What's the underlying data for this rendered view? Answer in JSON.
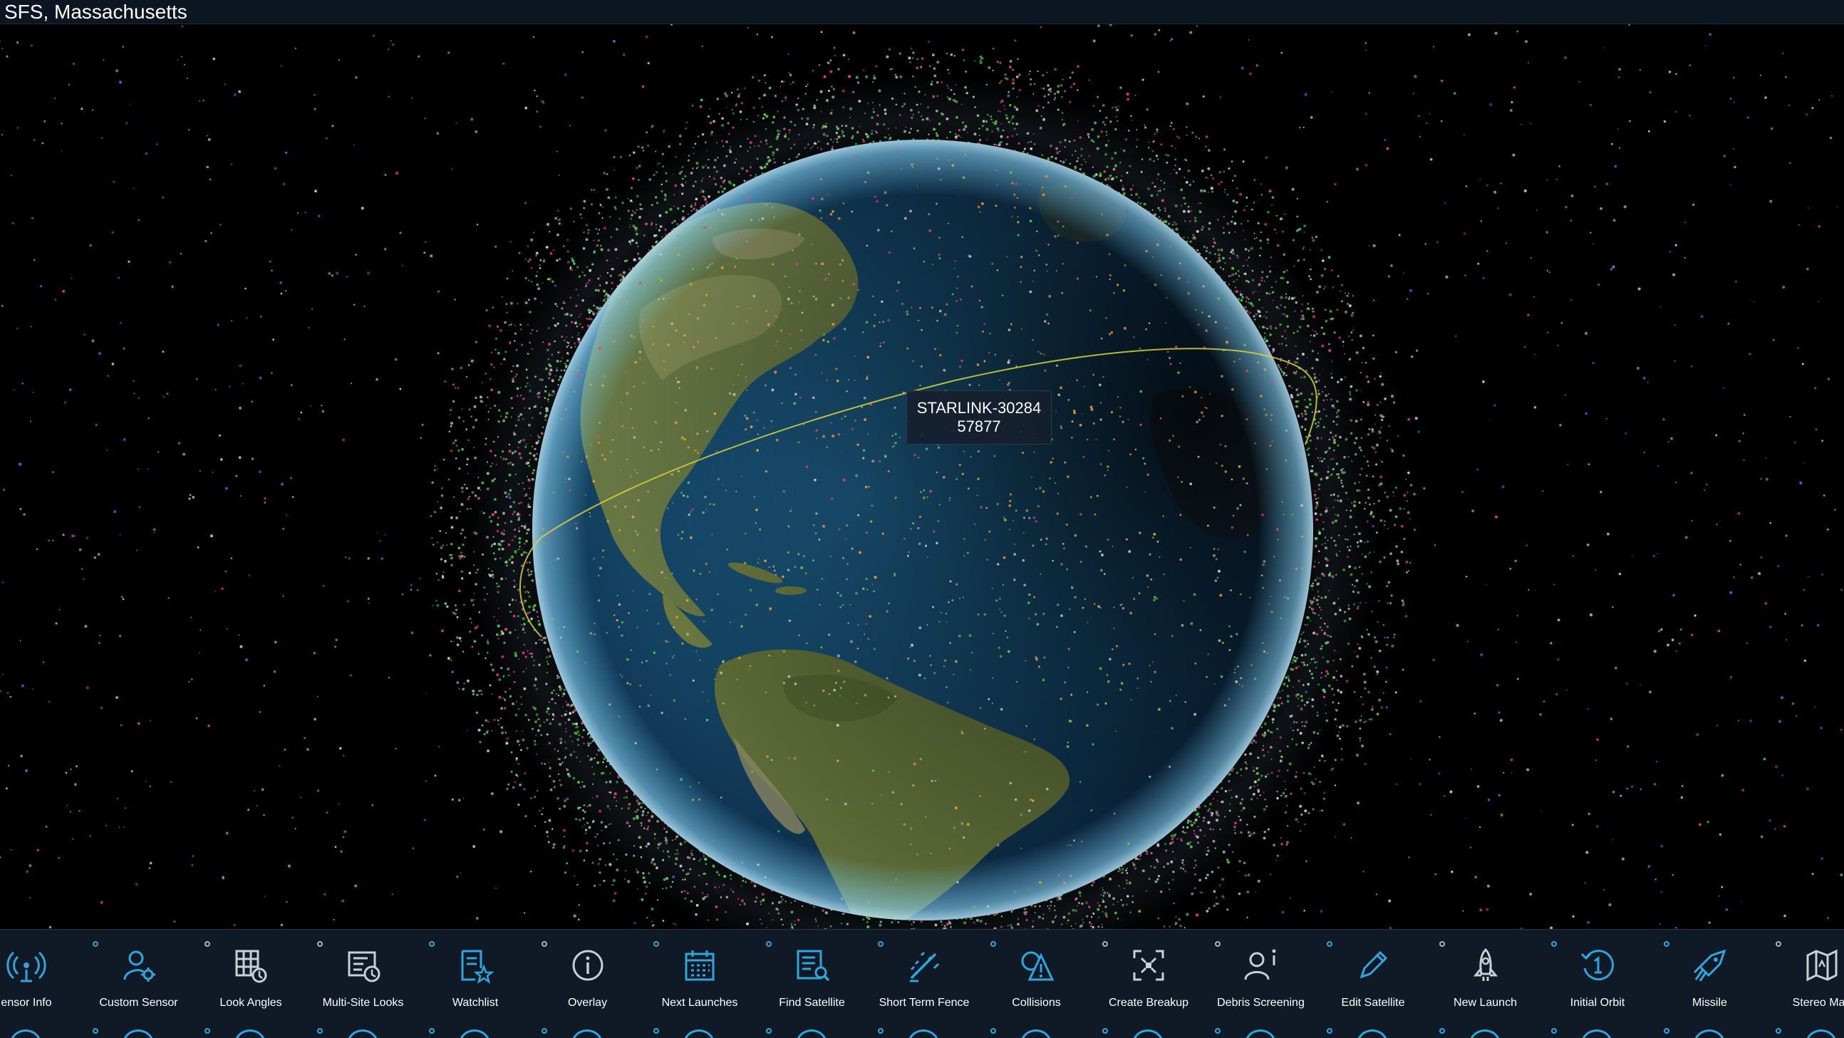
{
  "header": {
    "location": "SFS, Massachusetts"
  },
  "tooltip": {
    "name": "STARLINK-30284",
    "id": "57877"
  },
  "globe_view": {
    "collapse_icon": "triangle-down-icon"
  },
  "toolbar": {
    "items": [
      {
        "label": "ensor Info",
        "icon": "radar-icon",
        "indicator": "blue"
      },
      {
        "label": "Custom Sensor",
        "icon": "custom-sensor-icon",
        "indicator": "blue"
      },
      {
        "label": "Look Angles",
        "icon": "look-angles-icon",
        "indicator": "gray"
      },
      {
        "label": "Multi-Site Looks",
        "icon": "multi-site-looks-icon",
        "indicator": "gray"
      },
      {
        "label": "Watchlist",
        "icon": "watchlist-icon",
        "indicator": "blue"
      },
      {
        "label": "Overlay",
        "icon": "info-icon",
        "indicator": "gray"
      },
      {
        "label": "Next Launches",
        "icon": "calendar-icon",
        "indicator": "blue"
      },
      {
        "label": "Find Satellite",
        "icon": "find-satellite-icon",
        "indicator": "blue"
      },
      {
        "label": "Short Term Fence",
        "icon": "fence-icon",
        "indicator": "blue"
      },
      {
        "label": "Collisions",
        "icon": "collision-icon",
        "indicator": "blue"
      },
      {
        "label": "Create Breakup",
        "icon": "breakup-icon",
        "indicator": "gray"
      },
      {
        "label": "Debris Screening",
        "icon": "debris-screening-icon",
        "indicator": "gray"
      },
      {
        "label": "Edit Satellite",
        "icon": "pencil-icon",
        "indicator": "blue"
      },
      {
        "label": "New Launch",
        "icon": "rocket-icon",
        "indicator": "gray"
      },
      {
        "label": "Initial Orbit",
        "icon": "initial-orbit-icon",
        "indicator": "blue"
      },
      {
        "label": "Missile",
        "icon": "missile-icon",
        "indicator": "blue"
      },
      {
        "label": "Stereo Map",
        "icon": "map-icon",
        "indicator": "gray"
      }
    ]
  },
  "colors": {
    "background": "#000000",
    "accent": "#2ea6df",
    "toolbar_bg": "#0f1a26",
    "orbit_line": "#d8d33a",
    "debris_green": "#52d34a",
    "debris_orange": "#f0a030",
    "debris_gray": "#c8c8c8",
    "debris_magenta": "#e0408a",
    "payload_blue": "#4a6cf0"
  }
}
